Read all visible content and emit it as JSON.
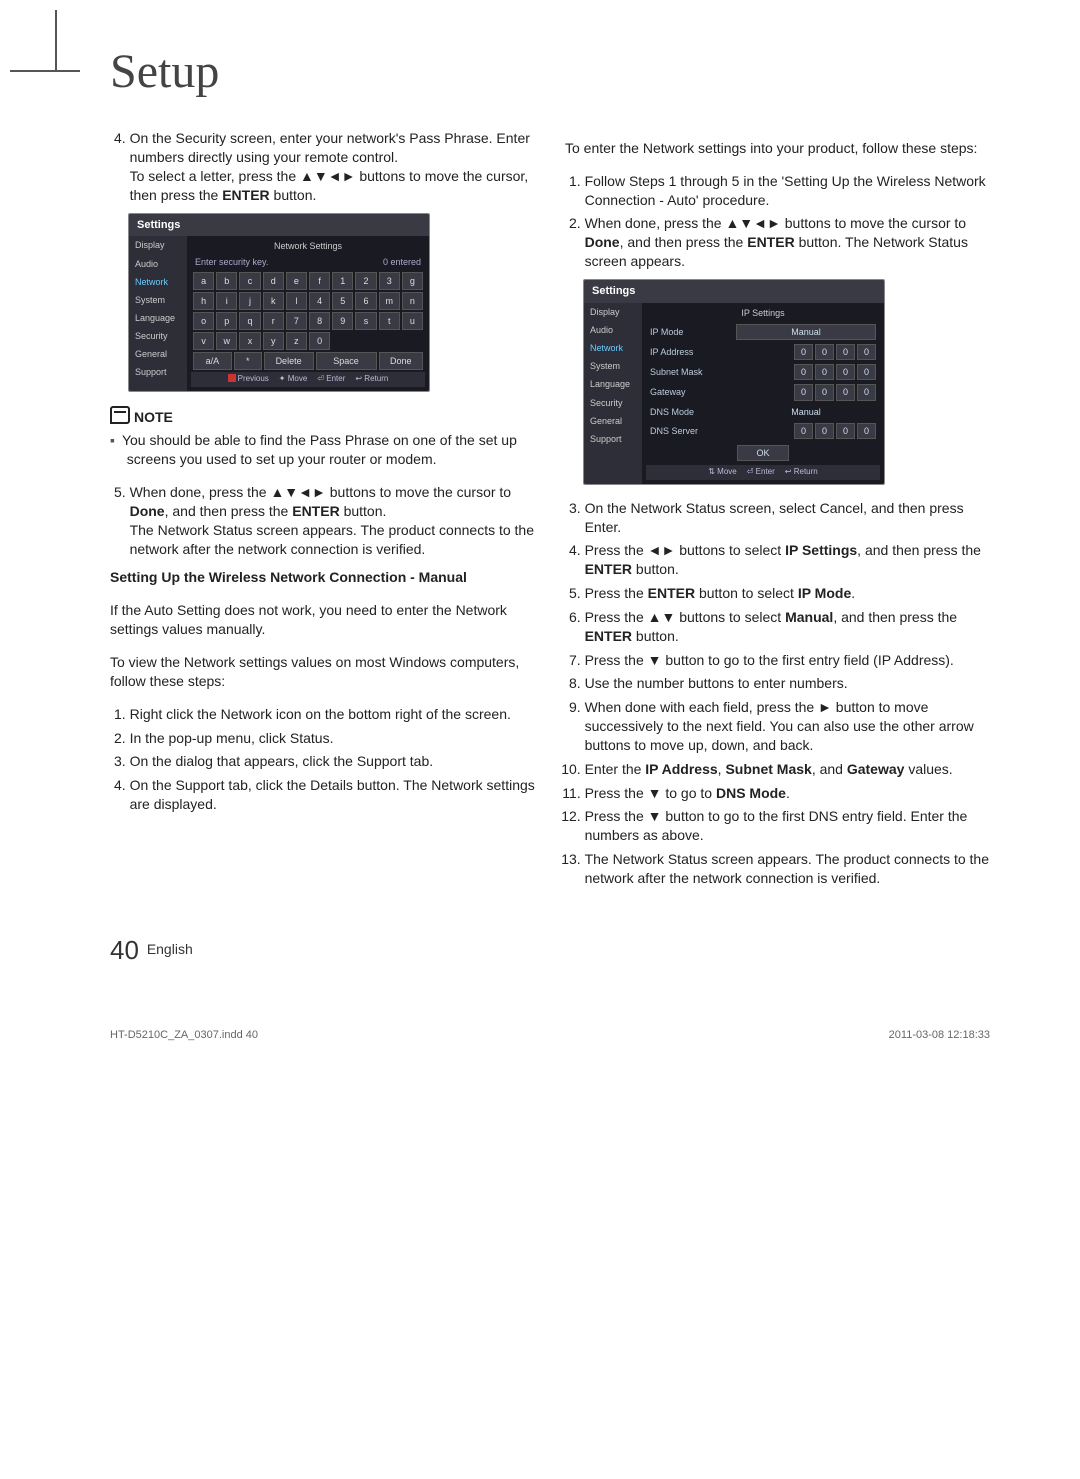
{
  "title": "Setup",
  "left": {
    "step4_a": "On the Security screen, enter your network's Pass Phrase. Enter numbers directly using your remote control.",
    "step4_b1": "To select a letter, press the ▲▼◄► buttons to move the cursor, then press the ",
    "step4_b1_bold": "ENTER",
    "step4_b2": " button.",
    "note_label": "NOTE",
    "note_text": "You should be able to find the Pass Phrase on one of the set up screens you used to set up your router or modem.",
    "step5_a": "When done, press the ▲▼◄► buttons to move the cursor to ",
    "step5_a_bold": "Done",
    "step5_b": ", and then press the ",
    "step5_b_bold": "ENTER",
    "step5_c": " button.",
    "step5_d": "The Network Status screen appears. The product connects to the network after the network connection is verified.",
    "section_head": "Setting Up the Wireless Network Connection - Manual",
    "p1": "If the Auto Setting does not work, you need to enter the Network settings values manually.",
    "p2": "To view the Network settings values on most Windows computers, follow these steps:",
    "win1": "Right click the Network icon on the bottom right of the screen.",
    "win2": "In the pop-up menu, click Status.",
    "win3": "On the dialog that appears, click the Support tab.",
    "win4": "On the Support tab, click the Details button. The Network settings are displayed."
  },
  "right": {
    "intro": "To enter the Network settings into your product, follow these steps:",
    "s1": "Follow Steps 1 through 5 in the 'Setting Up the Wireless Network Connection - Auto' procedure.",
    "s2_a": "When done, press the ▲▼◄► buttons to move the cursor to ",
    "s2_b": "Done",
    "s2_c": ", and then press the ",
    "s2_d": "ENTER",
    "s2_e": " button. The Network Status screen appears.",
    "s3": "On the Network Status screen, select Cancel, and then press Enter.",
    "s4_a": "Press the ◄► buttons to select ",
    "s4_b": "IP Settings",
    "s4_c": ", and then press the ",
    "s4_d": "ENTER",
    "s4_e": " button.",
    "s5_a": "Press the ",
    "s5_b": "ENTER",
    "s5_c": " button to select ",
    "s5_d": "IP Mode",
    "s5_e": ".",
    "s6_a": "Press the ▲▼ buttons to select ",
    "s6_b": "Manual",
    "s6_c": ", and then press the ",
    "s6_d": "ENTER",
    "s6_e": " button.",
    "s7": "Press the ▼ button to go to the first entry field (IP Address).",
    "s8": "Use the number buttons to enter numbers.",
    "s9": "When done with each field, press the ► button to move successively to the next field. You can also use the other arrow buttons to move up, down, and back.",
    "s10_a": "Enter the ",
    "s10_b": "IP Address",
    "s10_c": ", ",
    "s10_d": "Subnet Mask",
    "s10_e": ", and ",
    "s10_f": "Gateway",
    "s10_g": " values.",
    "s11_a": "Press the ▼ to go to ",
    "s11_b": "DNS Mode",
    "s11_c": ".",
    "s12": "Press the ▼ button to go to the first DNS entry field. Enter the numbers as above.",
    "s13": "The Network Status screen appears. The product connects to the network after the network connection is verified."
  },
  "panel1": {
    "title": "Settings",
    "sub": "Network Settings",
    "side": [
      "Display",
      "Audio",
      "Network",
      "System",
      "Language",
      "Security",
      "General",
      "Support"
    ],
    "sec_prompt": "Enter security key.",
    "sec_count": "0 entered",
    "keys": [
      "a",
      "b",
      "c",
      "d",
      "e",
      "f",
      "1",
      "2",
      "3",
      "g",
      "h",
      "i",
      "j",
      "k",
      "l",
      "4",
      "5",
      "6",
      "m",
      "n",
      "o",
      "p",
      "q",
      "r",
      "7",
      "8",
      "9",
      "s",
      "t",
      "u",
      "v",
      "w",
      "x",
      "y",
      "z",
      "0"
    ],
    "bottom": [
      "a/A",
      "*",
      "Delete",
      "Space",
      "Done"
    ],
    "bar": [
      "Previous",
      "Move",
      "Enter",
      "Return"
    ],
    "previous": "Previous",
    "move": "Move",
    "enter": "Enter",
    "return": "Return"
  },
  "panel2": {
    "title": "Settings",
    "sub": "IP Settings",
    "side": [
      "Display",
      "Audio",
      "Network",
      "System",
      "Language",
      "Security",
      "General",
      "Support"
    ],
    "ipmode_label": "IP Mode",
    "ipmode_value": "Manual",
    "rows": [
      {
        "label": "IP Address",
        "o": [
          "0",
          "0",
          "0",
          "0"
        ]
      },
      {
        "label": "Subnet Mask",
        "o": [
          "0",
          "0",
          "0",
          "0"
        ]
      },
      {
        "label": "Gateway",
        "o": [
          "0",
          "0",
          "0",
          "0"
        ]
      }
    ],
    "dnsmode_label": "DNS Mode",
    "dnsmode_value": "Manual",
    "dnsserver_label": "DNS Server",
    "dnsserver_o": [
      "0",
      "0",
      "0",
      "0"
    ],
    "ok": "OK",
    "bar_move": "Move",
    "bar_enter": "Enter",
    "bar_return": "Return"
  },
  "footer": {
    "page": "40",
    "lang": "English",
    "file": "HT-D5210C_ZA_0307.indd   40",
    "date": "2011-03-08   12:18:33"
  }
}
